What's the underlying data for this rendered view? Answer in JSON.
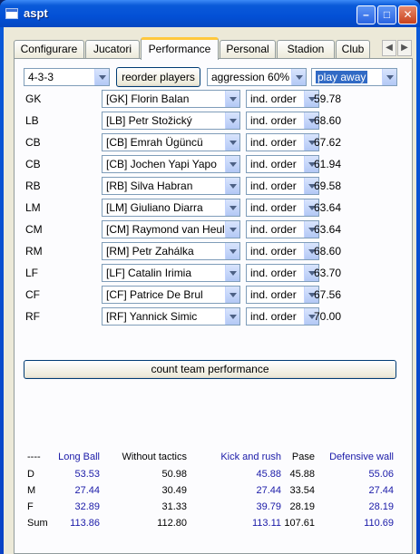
{
  "window": {
    "title": "aspt"
  },
  "tabs": [
    "Configurare",
    "Jucatori",
    "Performance",
    "Personal",
    "Stadion",
    "Club"
  ],
  "active_tab": "Performance",
  "controls": {
    "formation": "4-3-3",
    "reorder_label": "reorder players",
    "aggression": "aggression 60%",
    "venue": "play away"
  },
  "positions": [
    {
      "pos": "GK",
      "player": "[GK] Florin Balan",
      "order": "ind. order",
      "score": "59.78"
    },
    {
      "pos": "LB",
      "player": "[LB] Petr Stožický",
      "order": "ind. order",
      "score": "68.60"
    },
    {
      "pos": "CB",
      "player": "[CB] Emrah Ügüncü",
      "order": "ind. order",
      "score": "67.62"
    },
    {
      "pos": "CB",
      "player": "[CB] Jochen Yapi Yapo",
      "order": "ind. order",
      "score": "61.94"
    },
    {
      "pos": "RB",
      "player": "[RB] Silva Habran",
      "order": "ind. order",
      "score": "69.58"
    },
    {
      "pos": "LM",
      "player": "[LM] Giuliano Diarra",
      "order": "ind. order",
      "score": "63.64"
    },
    {
      "pos": "CM",
      "player": "[CM] Raymond van Heulen",
      "order": "ind. order",
      "score": "63.64"
    },
    {
      "pos": "RM",
      "player": "[RM] Petr Zahálka",
      "order": "ind. order",
      "score": "68.60"
    },
    {
      "pos": "LF",
      "player": "[LF] Catalin Irimia",
      "order": "ind. order",
      "score": "63.70"
    },
    {
      "pos": "CF",
      "player": "[CF] Patrice De Brul",
      "order": "ind. order",
      "score": "67.56"
    },
    {
      "pos": "RF",
      "player": "[RF] Yannick Simic",
      "order": "ind. order",
      "score": "70.00"
    }
  ],
  "count_label": "count team performance",
  "stats": {
    "headers": [
      "----",
      "Long Ball",
      "Without tactics",
      "Kick and rush",
      "Pase",
      "Defensive wall"
    ],
    "rows": [
      {
        "label": "D",
        "values": [
          "53.53",
          "50.98",
          "45.88",
          "45.88",
          "55.06"
        ]
      },
      {
        "label": "M",
        "values": [
          "27.44",
          "30.49",
          "27.44",
          "33.54",
          "27.44"
        ]
      },
      {
        "label": "F",
        "values": [
          "32.89",
          "31.33",
          "39.79",
          "28.19",
          "28.19"
        ]
      },
      {
        "label": "Sum",
        "values": [
          "113.86",
          "112.80",
          "113.11",
          "107.61",
          "110.69"
        ]
      }
    ]
  },
  "colors": {
    "accent_blue": "#1a1aa8",
    "selection": "#316ac5",
    "tab_highlight": "#ffc83c"
  }
}
